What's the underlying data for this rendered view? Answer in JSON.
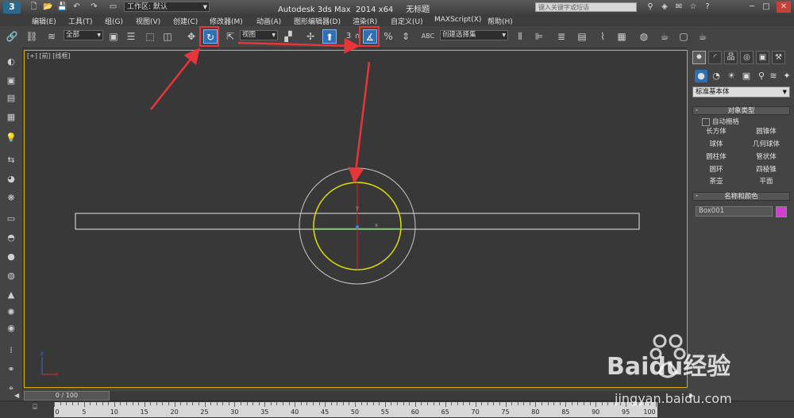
{
  "titlebar": {
    "workspace_label": "工作区: 默认",
    "window_title": "Autodesk 3ds Max  2014 x64     无标题",
    "search_placeholder": "键入关键字或短语"
  },
  "menu": [
    "编辑(E)",
    "工具(T)",
    "组(G)",
    "视图(V)",
    "创建(C)",
    "修改器(M)",
    "动画(A)",
    "图形编辑器(D)",
    "渲染(R)",
    "自定义(U)",
    "MAXScript(X)",
    "帮助(H)"
  ],
  "toolbar": {
    "selection_filter": "全部",
    "ref_coord": "视图",
    "angle_snap_label": "3",
    "percent_snap_label": "%",
    "named_selection": "创建选择集",
    "abc_label": "ABC"
  },
  "viewport": {
    "label": "[+] [前] [线框]"
  },
  "command_panel": {
    "category": "标准基本体",
    "object_type_title": "对象类型",
    "autogrid_label": "自动栅格",
    "objects": [
      "长方体",
      "圆锥体",
      "球体",
      "几何球体",
      "圆柱体",
      "管状体",
      "圆环",
      "四棱锥",
      "茶壶",
      "平面"
    ],
    "name_color_title": "名称和颜色",
    "object_name": "Box001",
    "object_color": "#d33fd3"
  },
  "timeline": {
    "frame_display": "0 / 100",
    "ticks": [
      "0",
      "5",
      "10",
      "15",
      "20",
      "25",
      "30",
      "35",
      "40",
      "45",
      "50",
      "55",
      "60",
      "65",
      "70",
      "75",
      "80",
      "85",
      "90",
      "95",
      "100"
    ]
  },
  "watermark": {
    "brand": "Baidu经验",
    "url": "jingyan.baidu.com"
  },
  "colors": {
    "active_tool": "#2f6fb3",
    "highlight": "#e8353a",
    "viewport_border": "#d4b000",
    "gizmo_yellow": "#e0e000"
  }
}
